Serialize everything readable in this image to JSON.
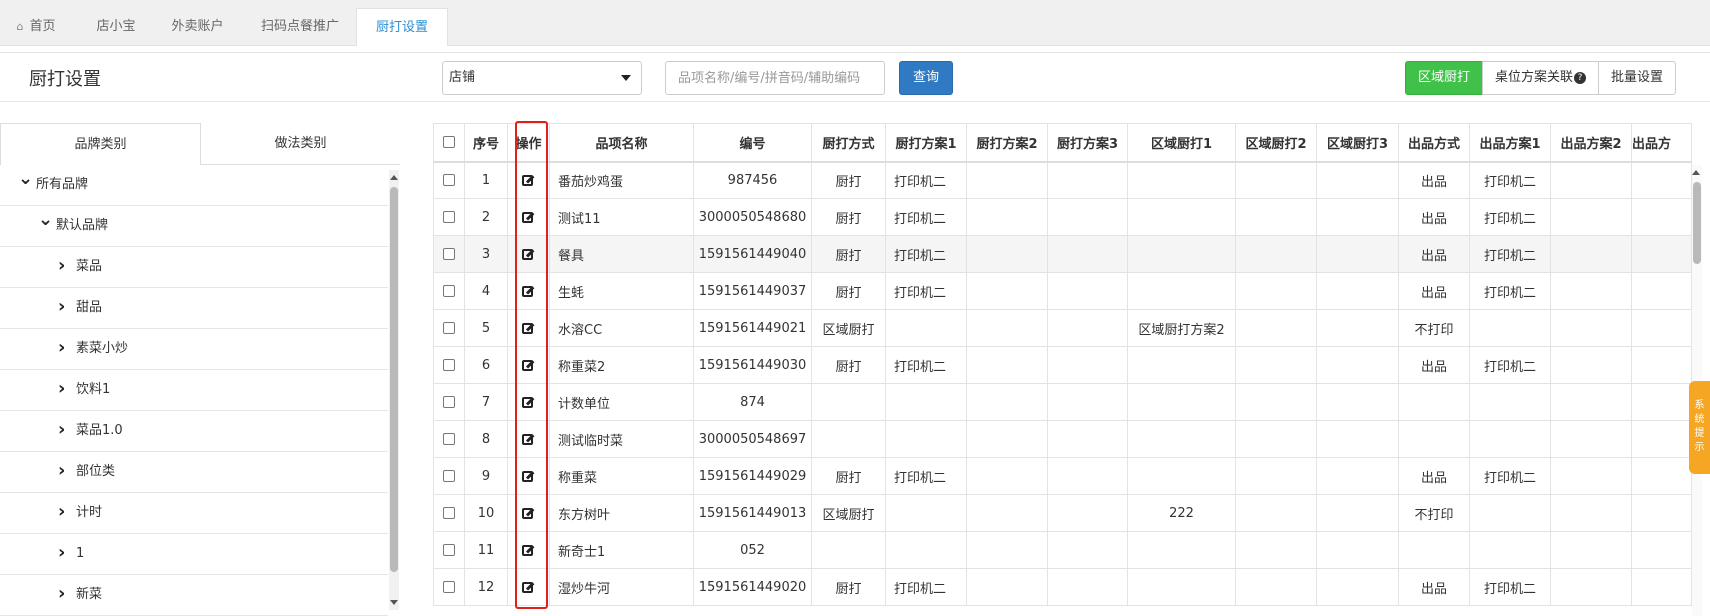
{
  "tabs": [
    {
      "label": "首页"
    },
    {
      "label": "店小宝"
    },
    {
      "label": "外卖账户"
    },
    {
      "label": "扫码点餐推广"
    },
    {
      "label": "厨打设置"
    }
  ],
  "toolbar": {
    "title": "厨打设置",
    "store_select": "店铺",
    "search_placeholder": "品项名称/编号/拼音码/辅助编码",
    "query_label": "查询",
    "area_print_label": "区域厨打",
    "table_plan_label": "桌位方案关联",
    "batch_label": "批量设置"
  },
  "left": {
    "tabs": [
      "品牌类别",
      "做法类别"
    ],
    "tree": [
      {
        "label": "所有品牌",
        "level": 0,
        "state": "expanded"
      },
      {
        "label": "默认品牌",
        "level": 1,
        "state": "expanded"
      },
      {
        "label": "菜品",
        "level": 2,
        "state": "collapsed"
      },
      {
        "label": "甜品",
        "level": 2,
        "state": "collapsed"
      },
      {
        "label": "素菜小炒",
        "level": 2,
        "state": "collapsed"
      },
      {
        "label": "饮料1",
        "level": 2,
        "state": "collapsed"
      },
      {
        "label": "菜品1.0",
        "level": 2,
        "state": "collapsed"
      },
      {
        "label": "部位类",
        "level": 2,
        "state": "collapsed"
      },
      {
        "label": "计时",
        "level": 2,
        "state": "collapsed"
      },
      {
        "label": "1",
        "level": 2,
        "state": "collapsed"
      },
      {
        "label": "新菜",
        "level": 2,
        "state": "collapsed"
      }
    ]
  },
  "table": {
    "columns": [
      "序号",
      "操作",
      "品项名称",
      "编号",
      "厨打方式",
      "厨打方案1",
      "厨打方案2",
      "厨打方案3",
      "区域厨打1",
      "区域厨打2",
      "区域厨打3",
      "出品方式",
      "出品方案1",
      "出品方案2",
      "出品方"
    ],
    "rows": [
      [
        "1",
        "番茄炒鸡蛋",
        "987456",
        "厨打",
        "打印机二",
        "",
        "",
        "",
        "",
        "",
        "出品",
        "打印机二",
        "",
        ""
      ],
      [
        "2",
        "测试11",
        "3000050548680",
        "厨打",
        "打印机二",
        "",
        "",
        "",
        "",
        "",
        "出品",
        "打印机二",
        "",
        ""
      ],
      [
        "3",
        "餐具",
        "1591561449040",
        "厨打",
        "打印机二",
        "",
        "",
        "",
        "",
        "",
        "出品",
        "打印机二",
        "",
        ""
      ],
      [
        "4",
        "生蚝",
        "1591561449037",
        "厨打",
        "打印机二",
        "",
        "",
        "",
        "",
        "",
        "出品",
        "打印机二",
        "",
        ""
      ],
      [
        "5",
        "水溶CC",
        "1591561449021",
        "区域厨打",
        "",
        "",
        "",
        "区域厨打方案2",
        "",
        "",
        "不打印",
        "",
        "",
        ""
      ],
      [
        "6",
        "称重菜2",
        "1591561449030",
        "厨打",
        "打印机二",
        "",
        "",
        "",
        "",
        "",
        "出品",
        "打印机二",
        "",
        ""
      ],
      [
        "7",
        "计数单位",
        "874",
        "",
        "",
        "",
        "",
        "",
        "",
        "",
        "",
        "",
        "",
        ""
      ],
      [
        "8",
        "测试临时菜",
        "3000050548697",
        "",
        "",
        "",
        "",
        "",
        "",
        "",
        "",
        "",
        "",
        ""
      ],
      [
        "9",
        "称重菜",
        "1591561449029",
        "厨打",
        "打印机二",
        "",
        "",
        "",
        "",
        "",
        "出品",
        "打印机二",
        "",
        ""
      ],
      [
        "10",
        "东方树叶",
        "1591561449013",
        "区域厨打",
        "",
        "",
        "",
        "222",
        "",
        "",
        "不打印",
        "",
        "",
        ""
      ],
      [
        "11",
        "新奇士1",
        "052",
        "",
        "",
        "",
        "",
        "",
        "",
        "",
        "",
        "",
        "",
        ""
      ],
      [
        "12",
        "湿炒牛河",
        "1591561449020",
        "厨打",
        "打印机二",
        "",
        "",
        "",
        "",
        "",
        "出品",
        "打印机二",
        "",
        ""
      ]
    ],
    "highlight_row": 3
  },
  "system_tip": "系统提示"
}
